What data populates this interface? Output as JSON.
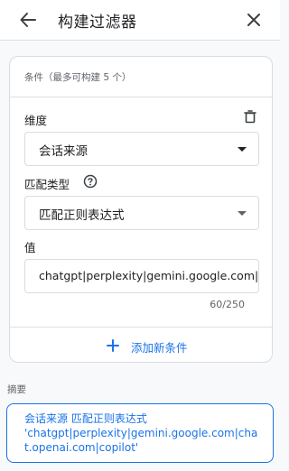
{
  "header": {
    "title": "构建过滤器",
    "back_icon": "arrow-back-icon",
    "close_icon": "close-icon"
  },
  "card": {
    "header_text": "条件（最多可构建 5 个）",
    "dimension": {
      "label": "维度",
      "value": "会话来源",
      "delete_icon": "trash-icon"
    },
    "match_type": {
      "label": "匹配类型",
      "help_icon": "help-circle-icon",
      "value": "匹配正则表达式"
    },
    "value_field": {
      "label": "值",
      "value": "chatgpt|perplexity|gemini.google.com|chat.openai.com|copilot",
      "counter": "60/250"
    },
    "add_condition": {
      "label": "添加新条件",
      "icon": "plus-icon"
    }
  },
  "summary": {
    "label": "摘要",
    "line1": "会话来源 匹配正则表达式",
    "line2": "'chatgpt|perplexity|gemini.google.com|chat.openai.com|copilot'"
  },
  "colors": {
    "accent": "#1a73e8",
    "background": "#f8f9fa",
    "border": "#dadce0"
  }
}
